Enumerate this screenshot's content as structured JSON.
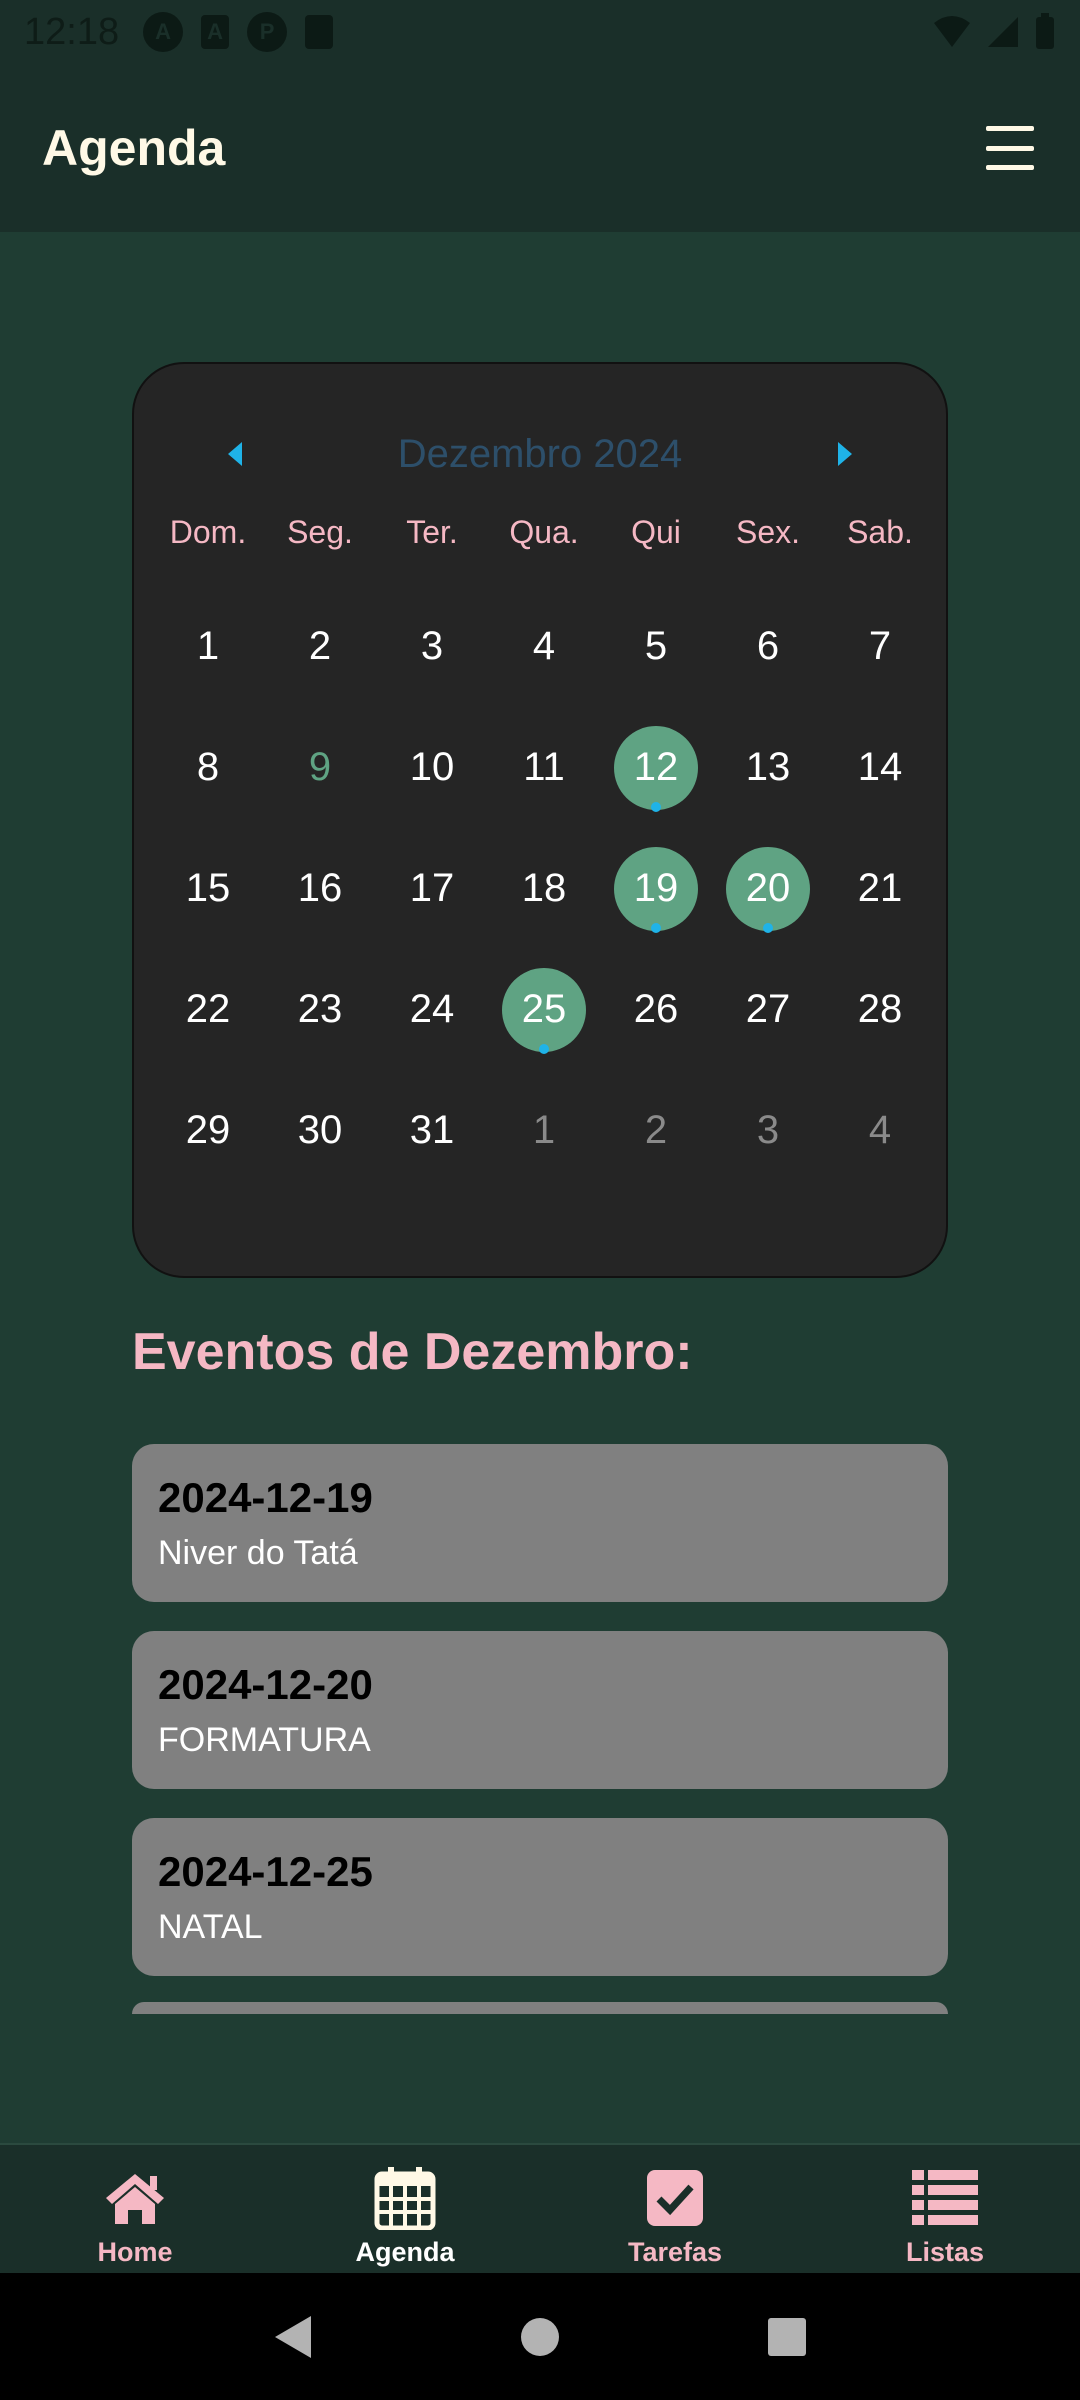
{
  "status_bar": {
    "time": "12:18"
  },
  "app_bar": {
    "title": "Agenda"
  },
  "calendar": {
    "month_label": "Dezembro 2024",
    "weekdays": [
      "Dom.",
      "Seg.",
      "Ter.",
      "Qua.",
      "Qui",
      "Sex.",
      "Sab."
    ],
    "days": [
      {
        "n": "1",
        "s": ""
      },
      {
        "n": "2",
        "s": ""
      },
      {
        "n": "3",
        "s": ""
      },
      {
        "n": "4",
        "s": ""
      },
      {
        "n": "5",
        "s": ""
      },
      {
        "n": "6",
        "s": ""
      },
      {
        "n": "7",
        "s": ""
      },
      {
        "n": "8",
        "s": ""
      },
      {
        "n": "9",
        "s": "today"
      },
      {
        "n": "10",
        "s": ""
      },
      {
        "n": "11",
        "s": ""
      },
      {
        "n": "12",
        "s": "marked"
      },
      {
        "n": "13",
        "s": ""
      },
      {
        "n": "14",
        "s": ""
      },
      {
        "n": "15",
        "s": ""
      },
      {
        "n": "16",
        "s": ""
      },
      {
        "n": "17",
        "s": ""
      },
      {
        "n": "18",
        "s": ""
      },
      {
        "n": "19",
        "s": "marked"
      },
      {
        "n": "20",
        "s": "marked"
      },
      {
        "n": "21",
        "s": ""
      },
      {
        "n": "22",
        "s": ""
      },
      {
        "n": "23",
        "s": ""
      },
      {
        "n": "24",
        "s": ""
      },
      {
        "n": "25",
        "s": "marked"
      },
      {
        "n": "26",
        "s": ""
      },
      {
        "n": "27",
        "s": ""
      },
      {
        "n": "28",
        "s": ""
      },
      {
        "n": "29",
        "s": ""
      },
      {
        "n": "30",
        "s": ""
      },
      {
        "n": "31",
        "s": ""
      },
      {
        "n": "1",
        "s": "other"
      },
      {
        "n": "2",
        "s": "other"
      },
      {
        "n": "3",
        "s": "other"
      },
      {
        "n": "4",
        "s": "other"
      }
    ]
  },
  "events": {
    "title": "Eventos de Dezembro:",
    "items": [
      {
        "date": "2024-12-19",
        "name": "Niver do Tatá"
      },
      {
        "date": "2024-12-20",
        "name": "FORMATURA"
      },
      {
        "date": "2024-12-25",
        "name": "NATAL"
      }
    ]
  },
  "bottom_nav": {
    "items": [
      {
        "label": "Home",
        "icon": "home-icon"
      },
      {
        "label": "Agenda",
        "icon": "calendar-icon"
      },
      {
        "label": "Tarefas",
        "icon": "checkbox-icon"
      },
      {
        "label": "Listas",
        "icon": "list-icon"
      }
    ],
    "active": "Agenda"
  },
  "colors": {
    "background": "#1f3d33",
    "app_bar": "#1a2f29",
    "calendar_bg": "#252525",
    "accent_pink": "#f5b8c4",
    "marked_day": "#5fa383",
    "event_dot": "#1fb3e8",
    "event_card": "#808080"
  }
}
